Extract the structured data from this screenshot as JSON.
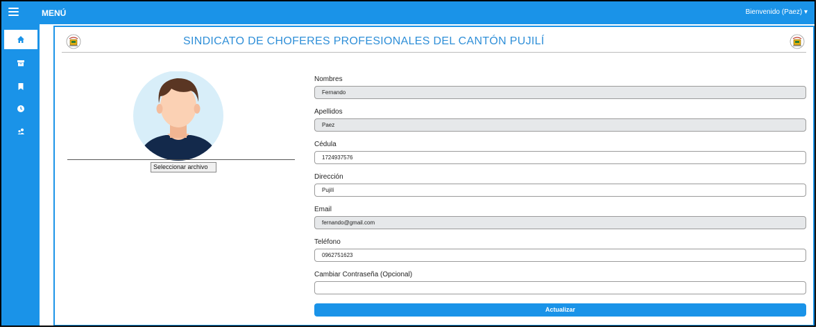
{
  "topbar": {
    "menu_label": "MENÚ",
    "user_label": "Bienvenido (Paez) ▾"
  },
  "sidebar": {
    "items": [
      {
        "icon": "home-icon",
        "active": true
      },
      {
        "icon": "box-icon",
        "active": false
      },
      {
        "icon": "bookmark-icon",
        "active": false
      },
      {
        "icon": "clock-icon",
        "active": false
      },
      {
        "icon": "users-icon",
        "active": false
      }
    ]
  },
  "header": {
    "title": "SINDICATO DE CHOFERES PROFESIONALES DEL CANTÓN PUJILÍ"
  },
  "profile": {
    "file_button": "Seleccionar archivo"
  },
  "form": {
    "nombres": {
      "label": "Nombres",
      "value": "Fernando"
    },
    "apellidos": {
      "label": "Apellidos",
      "value": "Paez"
    },
    "cedula": {
      "label": "Cédula",
      "value": "1724937576"
    },
    "direccion": {
      "label": "Dirección",
      "value": "Pujilí"
    },
    "email": {
      "label": "Email",
      "value": "fernando@gmail.com"
    },
    "telefono": {
      "label": "Teléfono",
      "value": "0962751623"
    },
    "password": {
      "label": "Cambiar Contraseña (Opcional)",
      "value": ""
    },
    "submit_label": "Actualizar"
  },
  "colors": {
    "primary": "#1a93e8",
    "readonly_bg": "#e6e8ea"
  }
}
